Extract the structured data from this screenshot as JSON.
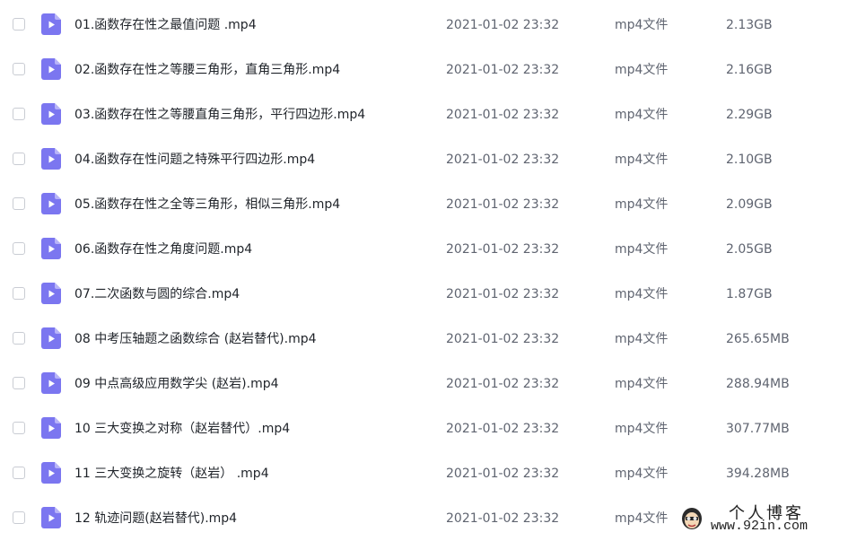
{
  "colors": {
    "icon_purple": "#7b76f0",
    "icon_fold": "#b7b3f8",
    "text_primary": "#1f2329",
    "text_secondary": "#5f6470"
  },
  "files": [
    {
      "name": "01.函数存在性之最值问题 .mp4",
      "date": "2021-01-02 23:32",
      "type": "mp4文件",
      "size": "2.13GB",
      "icon": "video-file-icon"
    },
    {
      "name": "02.函数存在性之等腰三角形，直角三角形.mp4",
      "date": "2021-01-02 23:32",
      "type": "mp4文件",
      "size": "2.16GB",
      "icon": "video-file-icon"
    },
    {
      "name": "03.函数存在性之等腰直角三角形，平行四边形.mp4",
      "date": "2021-01-02 23:32",
      "type": "mp4文件",
      "size": "2.29GB",
      "icon": "video-file-icon"
    },
    {
      "name": "04.函数存在性问题之特殊平行四边形.mp4",
      "date": "2021-01-02 23:32",
      "type": "mp4文件",
      "size": "2.10GB",
      "icon": "video-file-icon"
    },
    {
      "name": "05.函数存在性之全等三角形，相似三角形.mp4",
      "date": "2021-01-02 23:32",
      "type": "mp4文件",
      "size": "2.09GB",
      "icon": "video-file-icon"
    },
    {
      "name": "06.函数存在性之角度问题.mp4",
      "date": "2021-01-02 23:32",
      "type": "mp4文件",
      "size": "2.05GB",
      "icon": "video-file-icon"
    },
    {
      "name": "07.二次函数与圆的综合.mp4",
      "date": "2021-01-02 23:32",
      "type": "mp4文件",
      "size": "1.87GB",
      "icon": "video-file-icon"
    },
    {
      "name": "08 中考压轴题之函数综合 (赵岩替代).mp4",
      "date": "2021-01-02 23:32",
      "type": "mp4文件",
      "size": "265.65MB",
      "icon": "video-file-icon"
    },
    {
      "name": "09 中点高级应用数学尖 (赵岩).mp4",
      "date": "2021-01-02 23:32",
      "type": "mp4文件",
      "size": "288.94MB",
      "icon": "video-file-icon"
    },
    {
      "name": "10 三大变换之对称（赵岩替代）.mp4",
      "date": "2021-01-02 23:32",
      "type": "mp4文件",
      "size": "307.77MB",
      "icon": "video-file-icon"
    },
    {
      "name": "11 三大变换之旋转（赵岩） .mp4",
      "date": "2021-01-02 23:32",
      "type": "mp4文件",
      "size": "394.28MB",
      "icon": "video-file-icon"
    },
    {
      "name": "12 轨迹问题(赵岩替代).mp4",
      "date": "2021-01-02 23:32",
      "type": "mp4文件",
      "size": "",
      "icon": "video-file-icon"
    }
  ],
  "watermark": {
    "title": "个人博客",
    "url": "www.92in.com"
  }
}
